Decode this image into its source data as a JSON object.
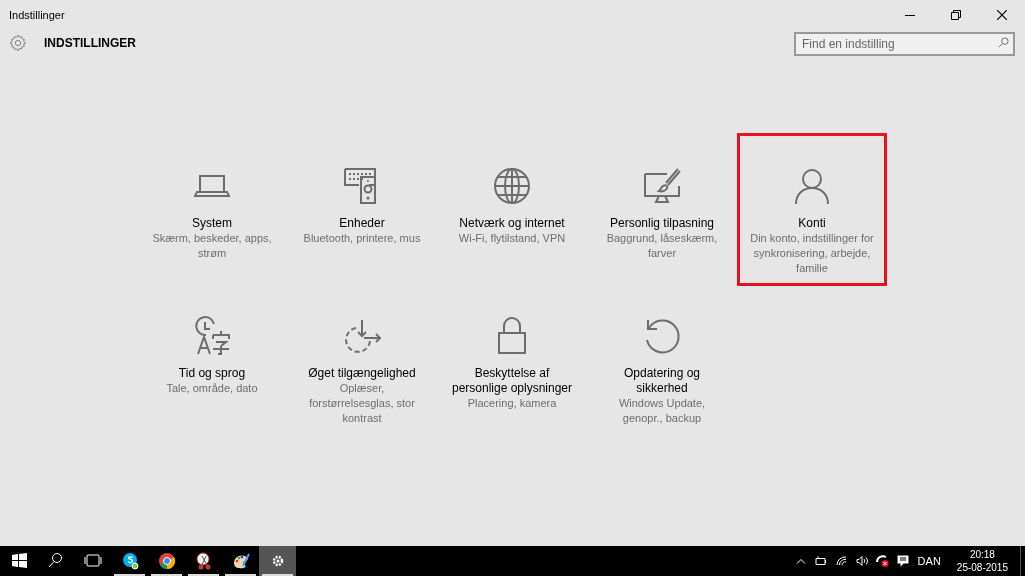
{
  "window": {
    "title": "Indstillinger"
  },
  "header": {
    "title": "INDSTILLINGER",
    "search": {
      "placeholder": "Find en indstilling"
    }
  },
  "tiles": [
    {
      "kind": "laptop",
      "title": "System",
      "description": "Skærm, beskeder, apps, strøm",
      "highlighted": false
    },
    {
      "kind": "devices",
      "title": "Enheder",
      "description": "Bluetooth, printere, mus",
      "highlighted": false
    },
    {
      "kind": "globe",
      "title": "Netværk og internet",
      "description": "Wi-Fi, flytilstand, VPN",
      "highlighted": false
    },
    {
      "kind": "paint",
      "title": "Personlig tilpasning",
      "description": "Baggrund, låseskærm, farver",
      "highlighted": false
    },
    {
      "kind": "person",
      "title": "Konti",
      "description": "Din konto, indstillinger for synkronisering, arbejde, familie",
      "highlighted": true
    },
    {
      "kind": "language",
      "title": "Tid og sprog",
      "description": "Tale, område, dato",
      "highlighted": false
    },
    {
      "kind": "ease",
      "title": "Øget tilgængelighed",
      "description": "Oplæser, forstørrelsesglas, stor kontrast",
      "highlighted": false
    },
    {
      "kind": "lock",
      "title": "Beskyttelse af personlige oplysninger",
      "description": "Placering, kamera",
      "highlighted": false
    },
    {
      "kind": "update",
      "title": "Opdatering og sikkerhed",
      "description": "Windows Update, genopr., backup",
      "highlighted": false
    }
  ],
  "taskbar": {
    "apps": [
      {
        "kind": "start",
        "running": false,
        "selected": false
      },
      {
        "kind": "search",
        "running": false,
        "selected": false
      },
      {
        "kind": "taskview",
        "running": false,
        "selected": false
      },
      {
        "kind": "skype",
        "running": true,
        "selected": false
      },
      {
        "kind": "chrome",
        "running": true,
        "selected": false
      },
      {
        "kind": "snip",
        "running": true,
        "selected": false
      },
      {
        "kind": "paint",
        "running": true,
        "selected": false
      },
      {
        "kind": "settings",
        "running": true,
        "selected": true
      }
    ],
    "language": "DAN",
    "time": "20:18",
    "date": "25-08-2015"
  }
}
